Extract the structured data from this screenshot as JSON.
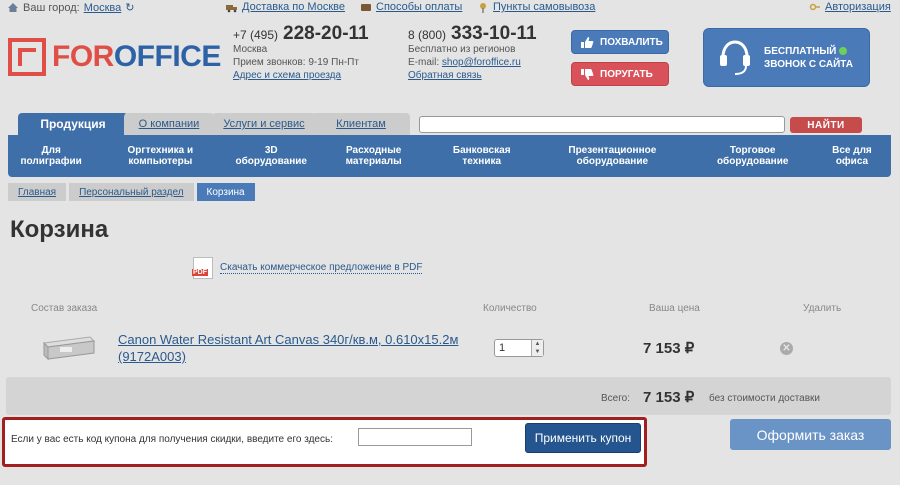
{
  "topbar": {
    "city_label": "Ваш город:",
    "city_value": "Москва",
    "delivery": "Доставка по Москве",
    "payment": "Способы оплаты",
    "pickup": "Пункты самовывоза",
    "login": "Авторизация"
  },
  "logo": {
    "part1": "FOR",
    "part2": "OFFICE"
  },
  "phone_moscow": {
    "code": "+7 (495)",
    "number": "228-20-11",
    "city": "Москва",
    "hours": "Прием звонков: 9-19 Пн-Пт",
    "address_link": "Адрес и схема проезда"
  },
  "phone_free": {
    "code": "8 (800)",
    "number": "333-10-11",
    "note": "Бесплатно из регионов",
    "email_label": "E-mail:",
    "email": "shop@foroffice.ru",
    "feedback_link": "Обратная связь"
  },
  "buttons": {
    "praise": "ПОХВАЛИТЬ",
    "complain": "ПОРУГАТЬ"
  },
  "callback": {
    "line1": "БЕСПЛАТНЫЙ",
    "line2": "ЗВОНОК С САЙТА"
  },
  "tabs": [
    "Продукция",
    "О компании",
    "Услуги и сервис",
    "Клиентам"
  ],
  "search": {
    "button": "НАЙТИ",
    "placeholder": ""
  },
  "categories": [
    "Для полиграфии",
    "Оргтехника и компьютеры",
    "3D оборудование",
    "Расходные материалы",
    "Банковская техника",
    "Презентационное оборудование",
    "Торговое оборудование",
    "Все для офиса"
  ],
  "breadcrumbs": [
    "Главная",
    "Персональный раздел",
    "Корзина"
  ],
  "page_title": "Корзина",
  "pdf_link": "Скачать коммерческое предложение в PDF",
  "table_headers": {
    "composition": "Состав заказа",
    "quantity": "Количество",
    "price": "Ваша цена",
    "remove": "Удалить"
  },
  "item": {
    "name": "Canon Water Resistant Art Canvas 340г/кв.м, 0.610х15.2м (9172A003)",
    "quantity": "1",
    "price": "7 153 ₽"
  },
  "total": {
    "label": "Всего:",
    "price": "7 153 ₽",
    "note": "без стоимости доставки"
  },
  "coupon": {
    "label": "Если у вас есть код купона для получения скидки, введите его здесь:",
    "value": "",
    "apply": "Применить купон"
  },
  "checkout": "Оформить заказ",
  "colors": {
    "brand_red": "#e04f47",
    "brand_blue": "#2d62a6",
    "nav_blue": "#3f6fa8",
    "highlight_border": "#a11f1f"
  }
}
